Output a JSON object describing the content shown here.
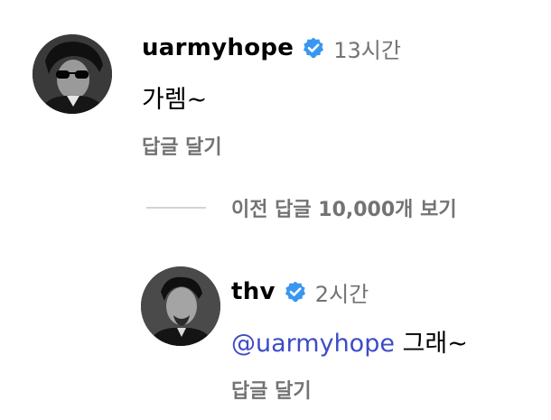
{
  "comment": {
    "avatar_icon": "profile-photo",
    "username": "uarmyhope",
    "verified_icon": "verified-badge-icon",
    "time": "13시간",
    "text": "가렘~",
    "reply_label": "답글 달기"
  },
  "view_previous": {
    "label": "이전 답글 10,000개 보기"
  },
  "reply": {
    "avatar_icon": "profile-photo",
    "username": "thv",
    "verified_icon": "verified-badge-icon",
    "time": "2시간",
    "mention": "@uarmyhope",
    "text": " 그래~",
    "reply_label": "답글 달기"
  },
  "colors": {
    "verified": "#3897f0",
    "mention": "#3d4cc6",
    "secondary_text": "#737373"
  }
}
